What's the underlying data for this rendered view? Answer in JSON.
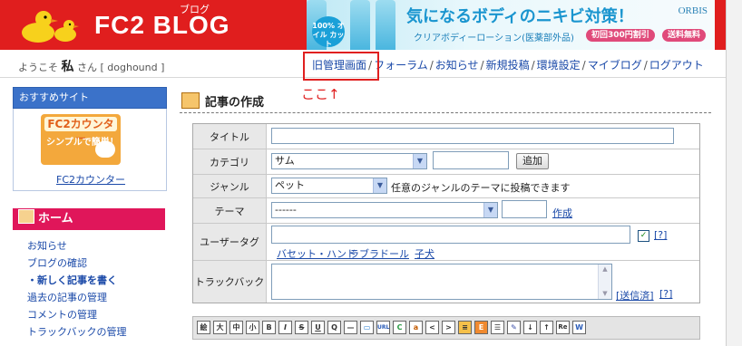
{
  "header": {
    "logo": "FC2 BLOG",
    "logo_sub": "ブログ",
    "ad": {
      "badge": "100% オイル カット",
      "title": "気になるボディのニキビ対策！",
      "brand": "ORBIS",
      "subtitle": "クリアボディーローション(医薬部外品)",
      "pill1": "初回300円割引",
      "pill2": "送料無料"
    }
  },
  "welcome": {
    "prefix": "ようこそ",
    "name": "私",
    "suffix": "さん",
    "user_id": "[ doghound ]"
  },
  "topnav": {
    "items": [
      "旧管理画面",
      "フォーラム",
      "お知らせ",
      "新規投稿",
      "環境設定",
      "マイブログ",
      "ログアウト"
    ]
  },
  "annotation": {
    "note": "ここ↑"
  },
  "sidebar": {
    "recommend_title": "おすすめサイト",
    "counter_title": "FC2カウンター",
    "counter_tagline": "シンプルで簡単！",
    "counter_link": "FC2カウンター",
    "home_title": "ホーム",
    "menu": [
      "お知らせ",
      "ブログの確認",
      "・新しく記事を書く",
      "過去の記事の管理",
      "コメントの管理",
      "トラックバックの管理"
    ]
  },
  "main": {
    "title": "記事の作成",
    "labels": {
      "title": "タイトル",
      "category": "カテゴリ",
      "genre": "ジャンル",
      "theme": "テーマ",
      "usertag": "ユーザータグ",
      "trackback": "トラックバック"
    },
    "category_value": "サム",
    "add_button": "追加",
    "genre_value": "ペット",
    "genre_note": "任意のジャンルのテーマに投稿できます",
    "theme_value": "------",
    "create_link": "作成",
    "help": "[?]",
    "tag_suggestions": [
      "バセット・ハンド",
      "ラブラドール",
      "子犬"
    ],
    "sent_link": "[送信済]"
  },
  "toolbar": {
    "icons": [
      "絵",
      "大",
      "中",
      "小",
      "B",
      "I",
      "S",
      "U",
      "Q",
      "—",
      "▭",
      "URL",
      "C",
      "a",
      "<",
      ">",
      "≡",
      "E",
      "☰",
      "✎",
      "↓",
      "↑",
      "Re",
      "W"
    ]
  }
}
